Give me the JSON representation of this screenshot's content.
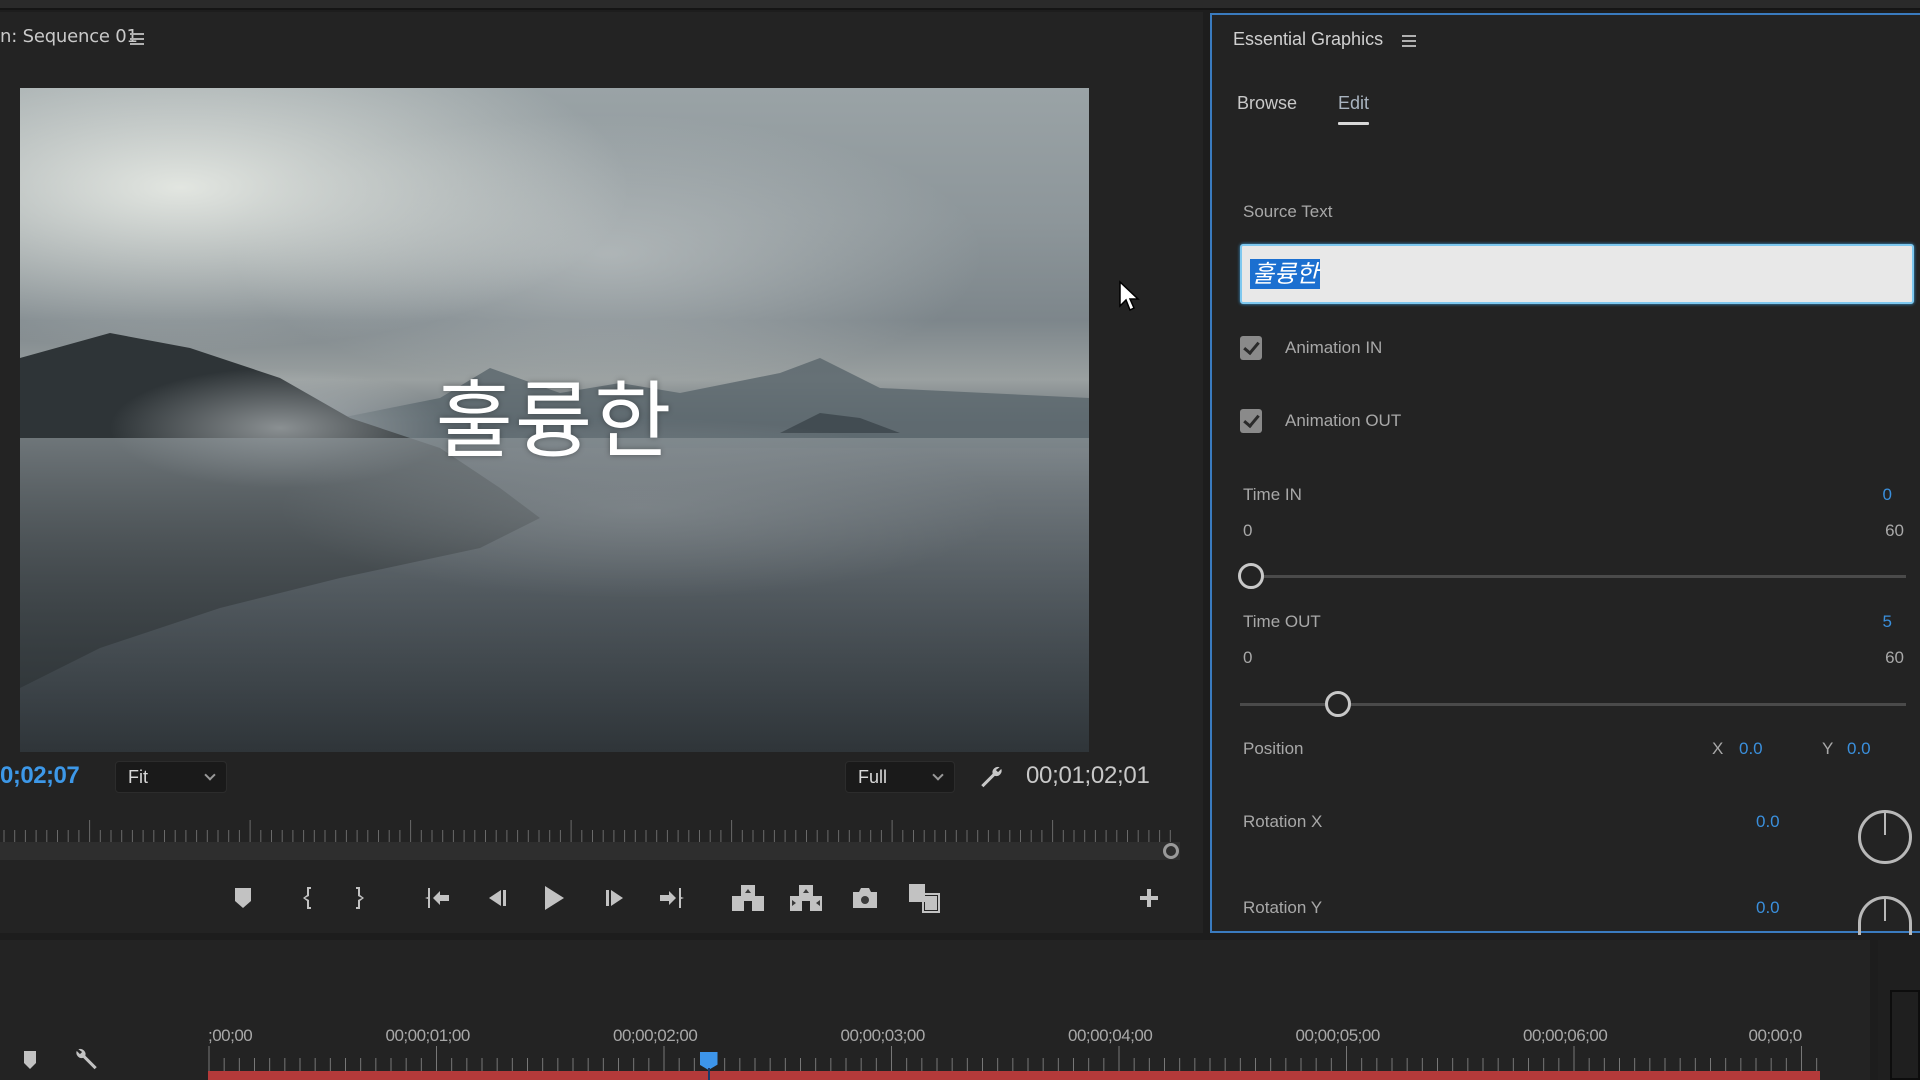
{
  "program_monitor": {
    "title": "n: Sequence 01",
    "menu_icon": "hamburger-menu-icon",
    "overlay_text": "훌륭한",
    "current_timecode": "0;02;07",
    "zoom_level": "Fit",
    "resolution": "Full",
    "duration_timecode": "00;01;02;01",
    "transport_buttons": [
      {
        "name": "add-marker",
        "icon": "marker-icon"
      },
      {
        "name": "mark-in",
        "icon": "mark-in-icon"
      },
      {
        "name": "mark-out",
        "icon": "mark-out-icon"
      },
      {
        "name": "go-to-in",
        "icon": "go-to-in-icon"
      },
      {
        "name": "step-back",
        "icon": "step-back-icon"
      },
      {
        "name": "play",
        "icon": "play-icon"
      },
      {
        "name": "step-forward",
        "icon": "step-forward-icon"
      },
      {
        "name": "go-to-out",
        "icon": "go-to-out-icon"
      },
      {
        "name": "lift",
        "icon": "lift-icon"
      },
      {
        "name": "extract",
        "icon": "extract-icon"
      },
      {
        "name": "export-frame",
        "icon": "camera-icon"
      },
      {
        "name": "comparison-view",
        "icon": "comparison-view-icon"
      },
      {
        "name": "button-editor",
        "icon": "plus-icon"
      }
    ]
  },
  "essential_graphics": {
    "title": "Essential Graphics",
    "tabs": [
      {
        "label": "Browse",
        "active": false
      },
      {
        "label": "Edit",
        "active": true
      }
    ],
    "source_text": {
      "label": "Source Text",
      "value": "훌륭한"
    },
    "animation_in": {
      "label": "Animation IN",
      "checked": true
    },
    "animation_out": {
      "label": "Animation OUT",
      "checked": true
    },
    "time_in": {
      "label": "Time IN",
      "value": "0",
      "min": "0",
      "max": "60",
      "fraction": 0.0
    },
    "time_out": {
      "label": "Time OUT",
      "value": "5",
      "min": "0",
      "max": "60",
      "fraction": 0.0833
    },
    "position": {
      "label": "Position",
      "x_label": "X",
      "x_value": "0.0",
      "y_label": "Y",
      "y_value": "0.0"
    },
    "rotation_x": {
      "label": "Rotation X",
      "value": "0.0"
    },
    "rotation_y": {
      "label": "Rotation Y",
      "value": "0.0"
    }
  },
  "timeline": {
    "ruler_labels": [
      ";00;00",
      "00;00;01;00",
      "00;00;02;00",
      "00;00;03;00",
      "00;00;04;00",
      "00;00;05;00",
      "00;00;06;00",
      "00;00;0"
    ],
    "playhead_seconds": 2.2
  },
  "colors": {
    "accent_blue": "#3a8fdc",
    "panel_focus_border": "#3a7bbf",
    "work_area_red": "#b43a3a",
    "selection_blue": "#1b6fd0"
  }
}
